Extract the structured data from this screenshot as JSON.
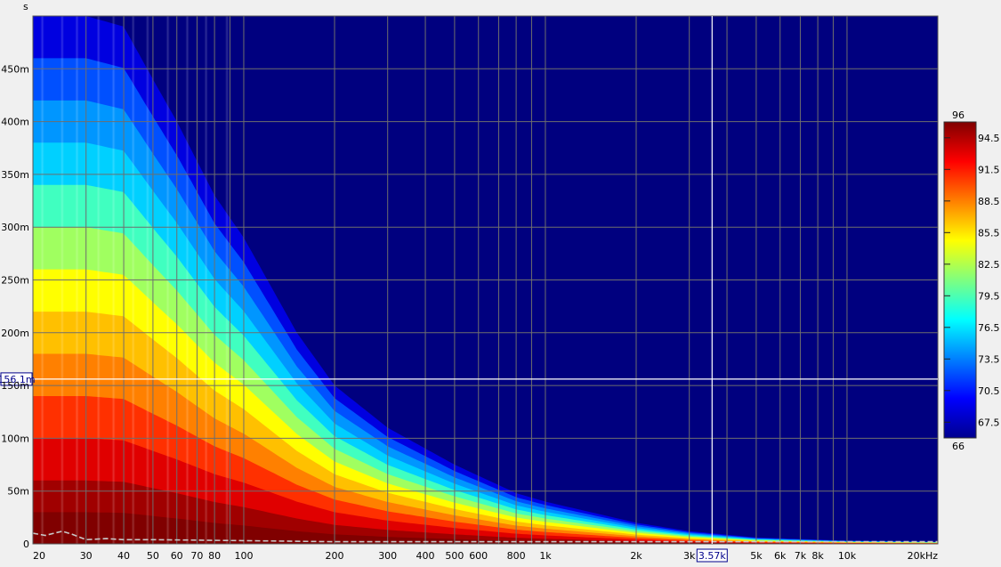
{
  "chart_data": {
    "type": "heatmap",
    "title": "",
    "xlabel": "",
    "ylabel": "",
    "y_unit": "s",
    "x_unit": "kHz",
    "x_scale": "log",
    "xlim": [
      20,
      20000
    ],
    "ylim": [
      0,
      0.5
    ],
    "x_tick_labels": [
      {
        "v": 20,
        "t": "20"
      },
      {
        "v": 30,
        "t": "30"
      },
      {
        "v": 40,
        "t": "40"
      },
      {
        "v": 50,
        "t": "50"
      },
      {
        "v": 60,
        "t": "60"
      },
      {
        "v": 70,
        "t": "70"
      },
      {
        "v": 80,
        "t": "80"
      },
      {
        "v": 100,
        "t": "100"
      },
      {
        "v": 200,
        "t": "200"
      },
      {
        "v": 300,
        "t": "300"
      },
      {
        "v": 400,
        "t": "400"
      },
      {
        "v": 500,
        "t": "500"
      },
      {
        "v": 600,
        "t": "600"
      },
      {
        "v": 800,
        "t": "800"
      },
      {
        "v": 1000,
        "t": "1k"
      },
      {
        "v": 2000,
        "t": "2k"
      },
      {
        "v": 3000,
        "t": "3k"
      },
      {
        "v": 5000,
        "t": "5k"
      },
      {
        "v": 6000,
        "t": "6k"
      },
      {
        "v": 7000,
        "t": "7k"
      },
      {
        "v": 8000,
        "t": "8k"
      },
      {
        "v": 10000,
        "t": "10k"
      },
      {
        "v": 20000,
        "t": "20kHz"
      }
    ],
    "x_gridlines": [
      20,
      30,
      40,
      50,
      60,
      70,
      80,
      90,
      100,
      200,
      300,
      400,
      500,
      600,
      700,
      800,
      900,
      1000,
      2000,
      3000,
      4000,
      5000,
      6000,
      7000,
      8000,
      9000,
      10000,
      20000
    ],
    "y_tick_labels": [
      {
        "v": 0,
        "t": "0"
      },
      {
        "v": 0.05,
        "t": "50m"
      },
      {
        "v": 0.1,
        "t": "100m"
      },
      {
        "v": 0.15,
        "t": "150m"
      },
      {
        "v": 0.2,
        "t": "200m"
      },
      {
        "v": 0.25,
        "t": "250m"
      },
      {
        "v": 0.3,
        "t": "300m"
      },
      {
        "v": 0.35,
        "t": "350m"
      },
      {
        "v": 0.4,
        "t": "400m"
      },
      {
        "v": 0.45,
        "t": "450m"
      }
    ],
    "grid": true,
    "colorbar": {
      "min": 66,
      "max": 96,
      "min_label": "66",
      "max_label": "96",
      "tick_labels": [
        {
          "v": 94.5,
          "t": "94.5"
        },
        {
          "v": 91.5,
          "t": "91.5"
        },
        {
          "v": 88.5,
          "t": "88.5"
        },
        {
          "v": 85.5,
          "t": "85.5"
        },
        {
          "v": 82.5,
          "t": "82.5"
        },
        {
          "v": 79.5,
          "t": "79.5"
        },
        {
          "v": 76.5,
          "t": "76.5"
        },
        {
          "v": 73.5,
          "t": "73.5"
        },
        {
          "v": 70.5,
          "t": "70.5"
        },
        {
          "v": 67.5,
          "t": "67.5"
        }
      ]
    },
    "decay_profile": {
      "freq": [
        20,
        25,
        30,
        40,
        50,
        60,
        80,
        100,
        150,
        200,
        300,
        500,
        800,
        1000,
        2000,
        3000,
        5000,
        10000,
        20000
      ],
      "decay_time_s": [
        0.5,
        0.5,
        0.5,
        0.49,
        0.44,
        0.4,
        0.33,
        0.29,
        0.2,
        0.15,
        0.11,
        0.075,
        0.048,
        0.04,
        0.02,
        0.012,
        0.006,
        0.003,
        0.002
      ]
    },
    "floor_line": {
      "freq": [
        20,
        22,
        25,
        27,
        30,
        35,
        40,
        50,
        100,
        200,
        500,
        1000,
        3000,
        10000,
        20000
      ],
      "time_s": [
        0.01,
        0.008,
        0.012,
        0.009,
        0.004,
        0.005,
        0.004,
        0.004,
        0.003,
        0.002,
        0.002,
        0.002,
        0.002,
        0.002,
        0.002
      ]
    },
    "cursor": {
      "freq": 3570,
      "freq_label": "3.57k",
      "time": 0.1561,
      "time_label": "156.1m"
    }
  },
  "colors": {
    "background": "#f0f0f0",
    "plot_background": "#00007f",
    "grid": "#6e6e6e",
    "cursor": "#ffffff"
  }
}
